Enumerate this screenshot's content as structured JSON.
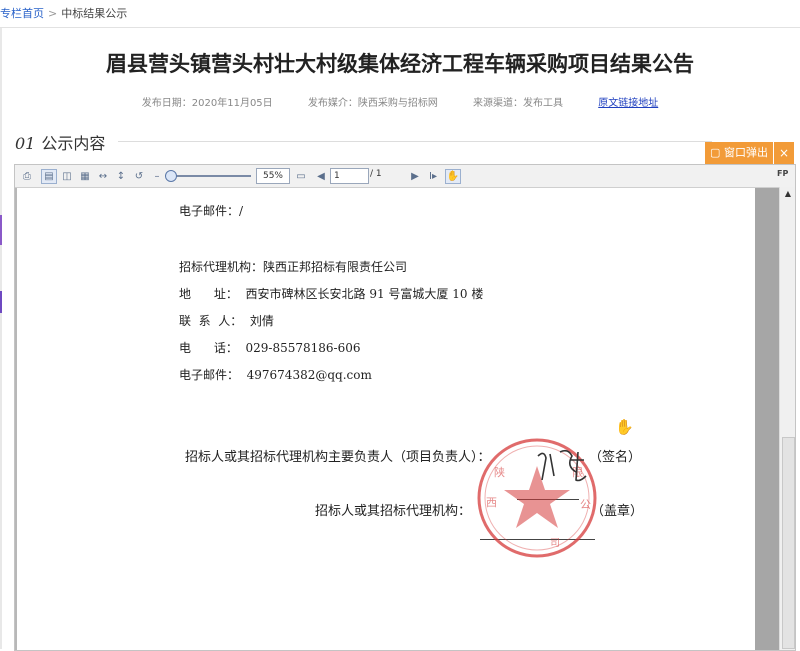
{
  "breadcrumb": {
    "home": "专栏首页",
    "separator": ">",
    "current": "中标结果公示"
  },
  "article": {
    "title": "眉县营头镇营头村壮大村级集体经济工程车辆采购项目结果公告",
    "publish_date": "发布日期：2020年11月05日",
    "media": "发布媒介：陕西采购与招标网",
    "source": "来源渠道：发布工具",
    "original_link": "原文链接地址"
  },
  "section": {
    "num": "01",
    "title": "公示内容"
  },
  "popup": {
    "label": "窗口弹出",
    "close": "×"
  },
  "viewer": {
    "zoom": "55%",
    "page_current": "1",
    "page_total": "/ 1",
    "fp": "FP"
  },
  "document": {
    "email_label_1": "电子邮件：/",
    "agency": "招标代理机构：陕西正邦招标有限责任公司",
    "address": "地      址：  西安市碑林区长安北路 91 号富城大厦 10 楼",
    "contact": "联  系  人：  刘倩",
    "phone": "电      话：  029-85578186-606",
    "email_2": "电子邮件：  497674382@qq.com",
    "sign_line": "招标人或其招标代理机构主要负责人（项目负责人）：",
    "sign_suffix": "（签名）",
    "seal_line": "招标人或其招标代理机构：",
    "seal_suffix": "（盖章）"
  },
  "colors": {
    "accent": "#f29b38",
    "link": "#2a62c9",
    "seal_red": "#d63a3a"
  }
}
